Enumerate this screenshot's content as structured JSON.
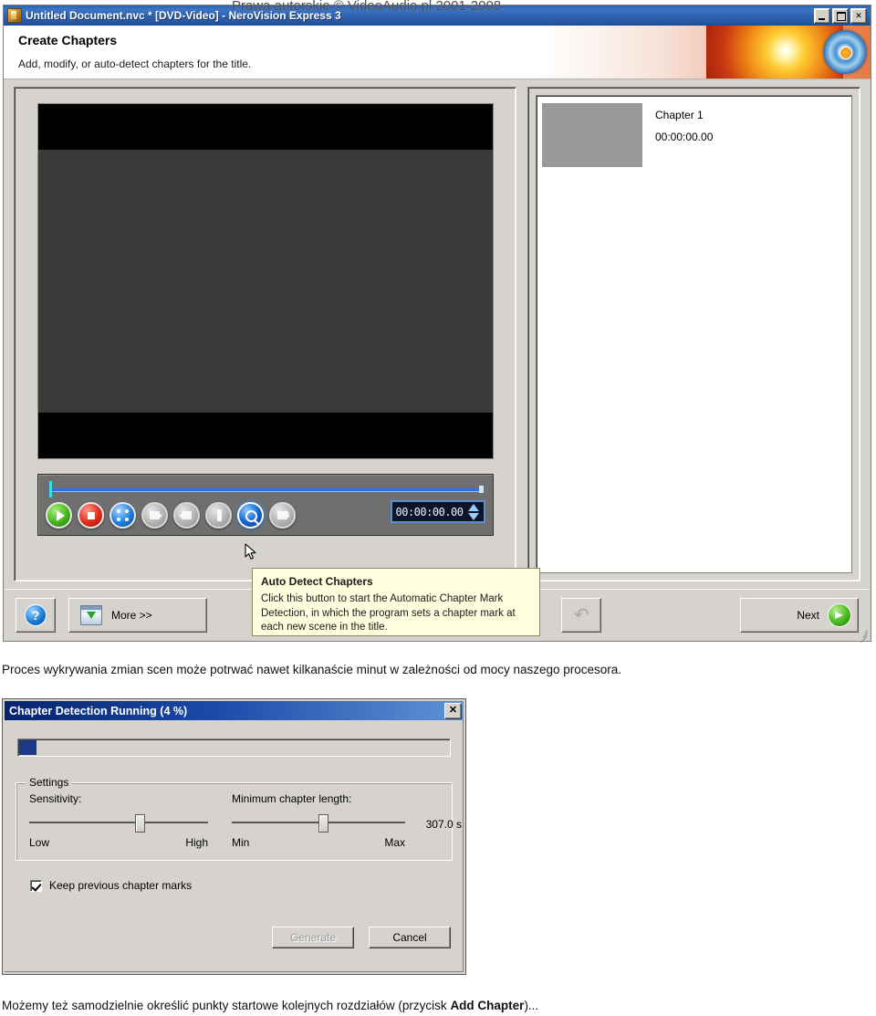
{
  "watermark": "Prawa autorskie © VideoAudio.pl 2001-2008",
  "nero_window": {
    "title": "Untitled Document.nvc * [DVD-Video] - NeroVision Express 3",
    "title_buttons": {
      "minimize": "_",
      "maximize": "□",
      "close": "X"
    },
    "header": {
      "heading": "Create Chapters",
      "subheading": "Add, modify, or auto-detect chapters for the title."
    },
    "player": {
      "timecode": "00:00:00.00",
      "buttons": [
        {
          "name": "play-button",
          "state": "enabled",
          "color": "#45b41f"
        },
        {
          "name": "stop-button",
          "state": "enabled",
          "color": "#e02a18"
        },
        {
          "name": "fullscreen-button",
          "state": "enabled",
          "color": "#1f7fe0"
        },
        {
          "name": "next-scene-button",
          "state": "disabled",
          "color": "#b4b4b4"
        },
        {
          "name": "previous-scene-button",
          "state": "disabled",
          "color": "#b4b4b4"
        },
        {
          "name": "set-chapter-mark-button",
          "state": "disabled",
          "color": "#b4b4b4"
        },
        {
          "name": "auto-detect-chapters-button",
          "state": "active-hover",
          "color": "#1466cf"
        },
        {
          "name": "add-chapter-button",
          "state": "disabled",
          "color": "#b4b4b4"
        }
      ]
    },
    "chapters": [
      {
        "name": "Chapter 1",
        "time": "00:00:00.00"
      }
    ],
    "tooltip": {
      "title": "Auto Detect Chapters",
      "body": "Click this button to start the Automatic Chapter Mark Detection, in which the program sets a chapter mark at each new scene in the title."
    },
    "commandbar": {
      "help_label": "?",
      "more_label": "More >>",
      "redo_label": "↷",
      "next_label": "Next"
    }
  },
  "paragraph_1": "Proces wykrywania zmian scen może potrwać nawet kilkanaście minut w zależności od mocy naszego procesora.",
  "paragraph_2_before": "Możemy też samodzielnie określić punkty startowe kolejnych rozdziałów (przycisk ",
  "paragraph_2_bold": "Add Chapter",
  "paragraph_2_after": ")...",
  "dialog": {
    "title": "Chapter Detection Running (4 %)",
    "close_label": "✕",
    "progress_percent": 4,
    "settings": {
      "legend": "Settings",
      "sensitivity": {
        "caption": "Sensitivity:",
        "min_label": "Low",
        "max_label": "High",
        "thumb_percent": 59
      },
      "min_chapter_length": {
        "caption": "Minimum chapter length:",
        "min_label": "Min",
        "max_label": "Max",
        "value": "307.0 s",
        "thumb_percent": 50
      }
    },
    "keep_marks_label": "Keep previous chapter marks",
    "keep_marks_checked": true,
    "generate_label": "Generate",
    "generate_disabled": true,
    "cancel_label": "Cancel"
  },
  "colors": {
    "titlebar_blue": "#2b5fae",
    "dialog_title_blue": "#06246e",
    "window_face": "#d6d3ce",
    "progress_fill": "#1b3a85",
    "tooltip_bg": "#ffffdf"
  }
}
